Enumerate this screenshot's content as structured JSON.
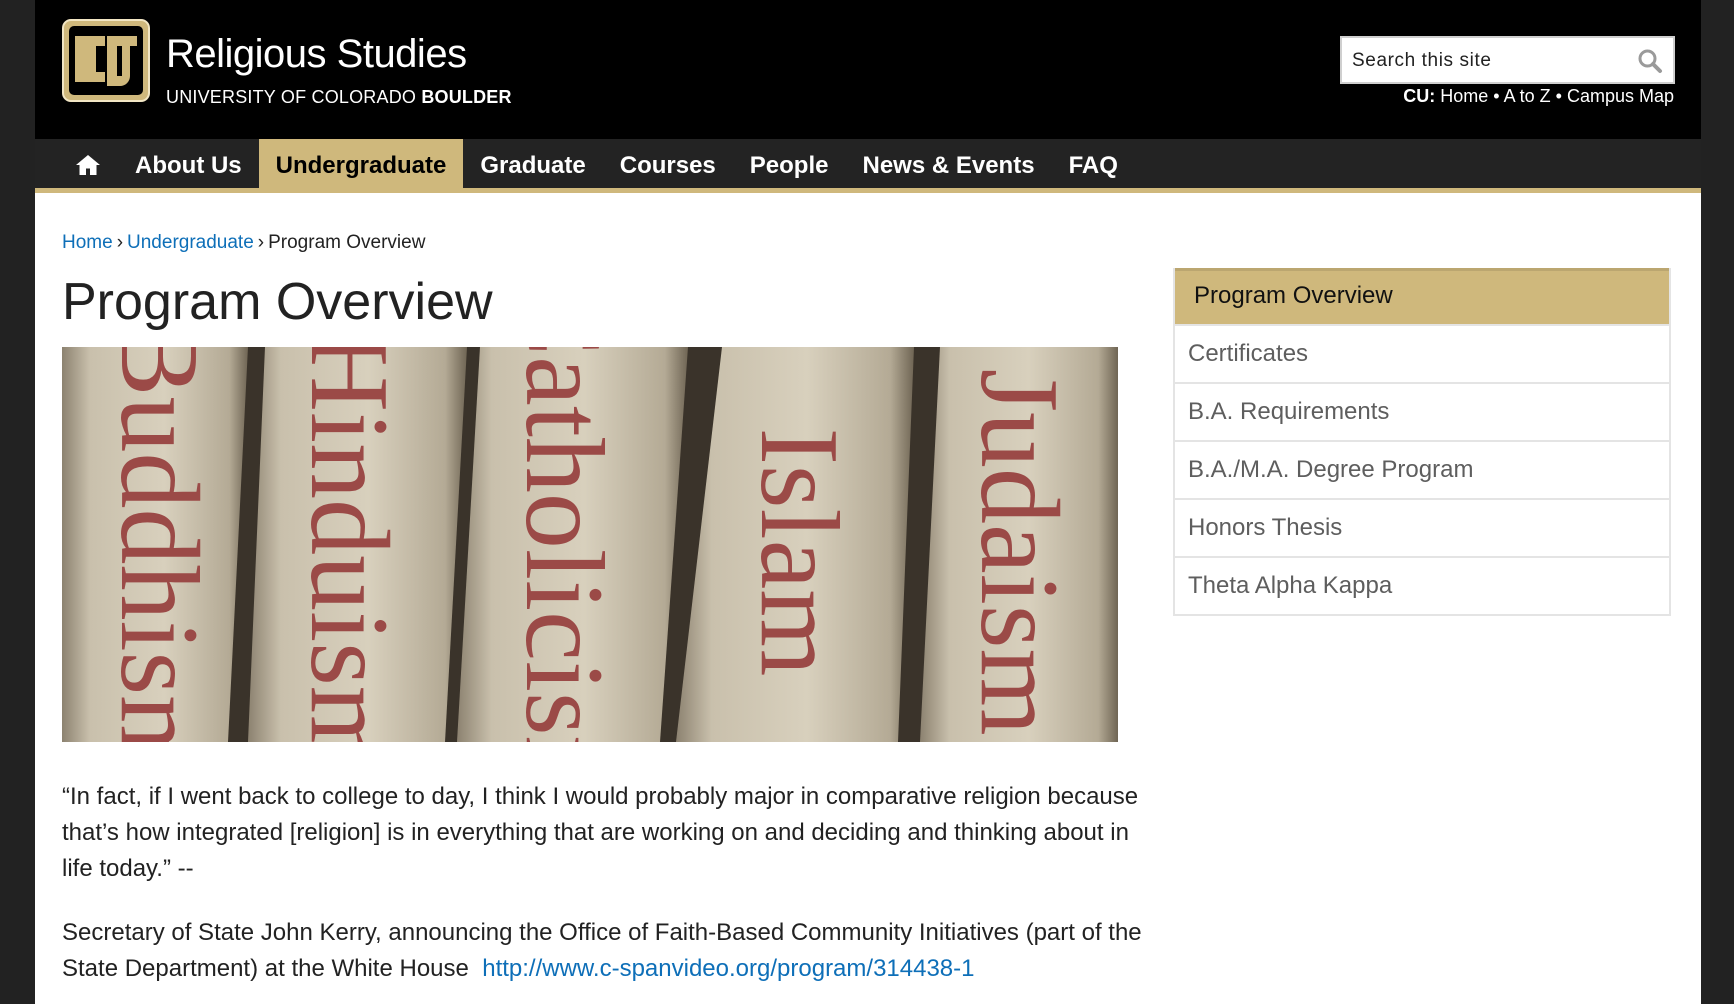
{
  "header": {
    "site_title": "Religious Studies",
    "site_subtitle_prefix": "UNIVERSITY OF COLORADO",
    "site_subtitle_bold": "BOULDER",
    "search_placeholder": "Search this site",
    "cu_label": "CU:",
    "cu_links": [
      "Home",
      "A to Z",
      "Campus Map"
    ],
    "cu_separator": "•"
  },
  "nav": {
    "home_icon": "home-icon",
    "items": [
      "About Us",
      "Undergraduate",
      "Graduate",
      "Courses",
      "People",
      "News & Events",
      "FAQ"
    ],
    "active": "Undergraduate"
  },
  "breadcrumb": {
    "items": [
      "Home",
      "Undergraduate"
    ],
    "current": "Program Overview",
    "separator": "›"
  },
  "main": {
    "title": "Program Overview",
    "hero_words": [
      "Buddhism",
      "Hinduism",
      "Catholicism",
      "Islam",
      "Judaism"
    ],
    "quote": "“In fact, if I went back to college to day, I think I would probably major in comparative religion because that’s how integrated [religion] is in everything that are working on and deciding and thinking about in life today.” --",
    "attribution": "Secretary of State John Kerry, announcing the Office of Faith-Based Community Initiatives (part of the State Department) at the White House",
    "link": "http://www.c-spanvideo.org/program/314438-1"
  },
  "sidebar": {
    "items": [
      "Program Overview",
      "Certificates",
      "B.A. Requirements",
      "B.A./M.A. Degree Program",
      "Honors Thesis",
      "Theta Alpha Kappa"
    ],
    "active": "Program Overview"
  },
  "colors": {
    "gold": "#cfb87c",
    "black": "#000000",
    "nav_bg": "#232323",
    "link": "#0e6fb8"
  }
}
